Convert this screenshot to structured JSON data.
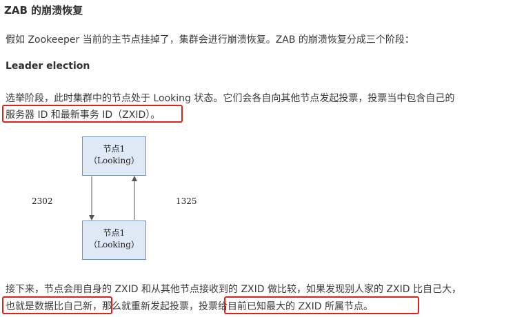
{
  "heading": "ZAB 的崩溃恢复",
  "intro": "假如 Zookeeper 当前的主节点挂掉了，集群会进行崩溃恢复。ZAB 的崩溃恢复分成三个阶段：",
  "subheading": "Leader election",
  "election_para": {
    "line1": "选举阶段，此时集群中的节点处于 Looking 状态。它们会各自向其他节点发起投票，投票当中包含自己的",
    "line2": "服务器 ID 和最新事务 ID（ZXID）。"
  },
  "diagram": {
    "top_node": {
      "title": "节点1",
      "state": "（Looking）"
    },
    "bottom_node": {
      "title": "节点1",
      "state": "（Looking）"
    },
    "left_label": "2302",
    "right_label": "1325"
  },
  "closing_para": {
    "line1": "接下来，节点会用自身的 ZXID 和从其他节点接收到的 ZXID 做比较，如果发现别人家的 ZXID 比自己大，",
    "line2_part1": "也就是数据比自己新",
    "line2_part2": "，那么就重新发起投票，",
    "line2_part3": "投票给目前已知最大的 ZXID 所属节点。"
  },
  "colors": {
    "highlight": "#e0201c",
    "node_fill": "#dfe9f6",
    "node_border": "#6f8fb8"
  }
}
